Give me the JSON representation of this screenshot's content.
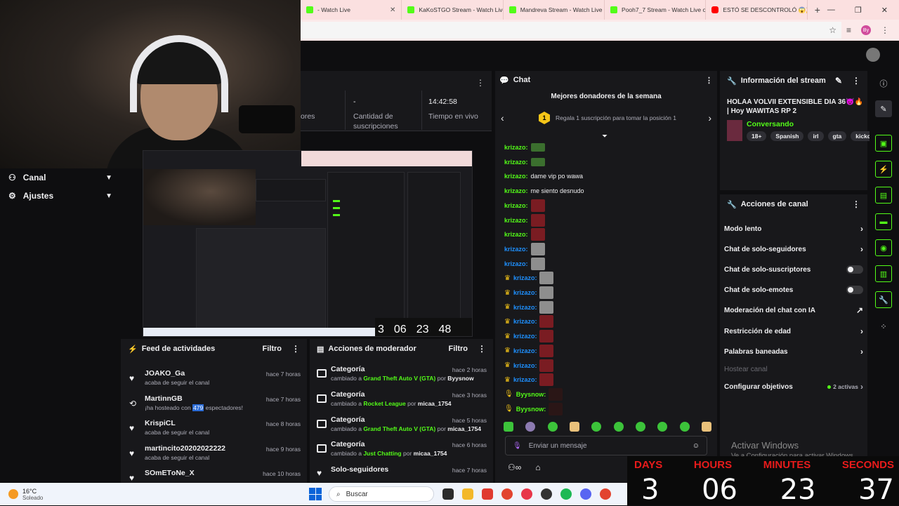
{
  "browser": {
    "tabs": [
      {
        "label": "- Watch Live",
        "icon": "kick-icon"
      },
      {
        "label": "KaKoSTGO Stream - Watch Live",
        "icon": "kick-icon"
      },
      {
        "label": "Mandreva Stream - Watch Live",
        "icon": "kick-icon"
      },
      {
        "label": "Pooh7_7 Stream - Watch Live o",
        "icon": "kick-icon"
      },
      {
        "label": "ESTÓ SE DESCONTROLÓ 😱🎉 ",
        "icon": "youtube-icon"
      }
    ],
    "new_tab": "+",
    "window_controls": [
      "—",
      "❐",
      "✕"
    ],
    "profile_initials": "By"
  },
  "stats": {
    "left_label": "ores",
    "subs_value": "-",
    "subs_label": "Cantidad de suscripciones",
    "uptime_value": "14:42:58",
    "uptime_label": "Tiempo en vivo"
  },
  "sidebar": {
    "items": [
      {
        "label": "Canal",
        "icon": "channel-icon"
      },
      {
        "label": "Ajustes",
        "icon": "settings-icon"
      }
    ]
  },
  "preview_timer": {
    "d": "3",
    "h": "06",
    "m": "23",
    "s": "48"
  },
  "activity_feed": {
    "title": "Feed de actividades",
    "filter": "Filtro",
    "items": [
      {
        "name": "JOAKO_Ga",
        "time": "hace 7 horas",
        "desc": "acaba de seguir el canal",
        "icon": "heart-icon"
      },
      {
        "name": "MartinnGB",
        "time": "hace 7 horas",
        "desc_pre": "¡ha hosteado con ",
        "desc_num": "479",
        "desc_post": " espectadores!",
        "icon": "host-icon"
      },
      {
        "name": "KrispiCL",
        "time": "hace 8 horas",
        "desc": "acaba de seguir el canal",
        "icon": "heart-icon"
      },
      {
        "name": "martincito20202022222",
        "time": "hace 9 horas",
        "desc": "acaba de seguir el canal",
        "icon": "heart-icon"
      },
      {
        "name": "SOmETоNe_X",
        "time": "hace 10 horas",
        "desc": "",
        "icon": "heart-icon"
      }
    ]
  },
  "mod_actions": {
    "title": "Acciones de moderador",
    "filter": "Filtro",
    "items": [
      {
        "title": "Categoría",
        "time": "hace 2 horas",
        "pre": "cambiado a ",
        "value": "Grand Theft Auto V (GTA)",
        "by": " por ",
        "user": "Byysnow"
      },
      {
        "title": "Categoría",
        "time": "hace 3 horas",
        "pre": "cambiado a ",
        "value": "Rocket League",
        "by": " por ",
        "user": "micaa_1754"
      },
      {
        "title": "Categoría",
        "time": "hace 5 horas",
        "pre": "cambiado a ",
        "value": "Grand Theft Auto V (GTA)",
        "by": " por ",
        "user": "micaa_1754"
      },
      {
        "title": "Categoría",
        "time": "hace 6 horas",
        "pre": "cambiado a ",
        "value": "Just Chatting",
        "by": " por ",
        "user": "micaa_1754"
      },
      {
        "title": "Solo-seguidores",
        "time": "hace 7 horas",
        "pre": "",
        "value": "",
        "by": "",
        "user": ""
      }
    ]
  },
  "chat": {
    "title": "Chat",
    "donors_title": "Mejores donadores de la semana",
    "donor_rank": "1",
    "donor_text": "Regala 1 suscripción para tomar la posición 1",
    "messages": [
      {
        "user": "krizazo:",
        "text": "",
        "emote": "grn",
        "color": "#53fc18",
        "crown": false
      },
      {
        "user": "krizazo:",
        "text": "",
        "emote": "grn",
        "color": "#53fc18",
        "crown": false
      },
      {
        "user": "krizazo:",
        "text": "dame vip po wawa",
        "emote": "",
        "color": "#53fc18",
        "crown": false
      },
      {
        "user": "krizazo:",
        "text": "me siento desnudo",
        "emote": "",
        "color": "#53fc18",
        "crown": false
      },
      {
        "user": "krizazo:",
        "text": "",
        "emote": "red",
        "color": "#53fc18",
        "crown": false
      },
      {
        "user": "krizazo:",
        "text": "",
        "emote": "red",
        "color": "#53fc18",
        "crown": false
      },
      {
        "user": "krizazo:",
        "text": "",
        "emote": "red",
        "color": "#53fc18",
        "crown": false
      },
      {
        "user": "krizazo:",
        "text": "",
        "emote": "gry",
        "color": "#1e90ff",
        "crown": false
      },
      {
        "user": "krizazo:",
        "text": "",
        "emote": "gry",
        "color": "#1e90ff",
        "crown": false
      },
      {
        "user": "krizazo:",
        "text": "",
        "emote": "gry",
        "color": "#1e90ff",
        "crown": true
      },
      {
        "user": "krizazo:",
        "text": "",
        "emote": "gry",
        "color": "#1e90ff",
        "crown": true
      },
      {
        "user": "krizazo:",
        "text": "",
        "emote": "gry",
        "color": "#1e90ff",
        "crown": true
      },
      {
        "user": "krizazo:",
        "text": "",
        "emote": "red",
        "color": "#1e90ff",
        "crown": true
      },
      {
        "user": "krizazo:",
        "text": "",
        "emote": "red",
        "color": "#1e90ff",
        "crown": true
      },
      {
        "user": "krizazo:",
        "text": "",
        "emote": "red",
        "color": "#1e90ff",
        "crown": true
      },
      {
        "user": "krizazo:",
        "text": "",
        "emote": "red",
        "color": "#1e90ff",
        "crown": true
      },
      {
        "user": "krizazo:",
        "text": "",
        "emote": "red",
        "color": "#1e90ff",
        "crown": true
      },
      {
        "user": "Byysnow:",
        "text": "",
        "emote": "dk",
        "color": "#53fc18",
        "crown": false
      },
      {
        "user": "Byysnow:",
        "text": "",
        "emote": "dk",
        "color": "#53fc18",
        "crown": false
      }
    ],
    "input_placeholder": "Enviar un mensaje"
  },
  "stream_info": {
    "title": "Información del stream",
    "stream_title": "HOLAA VOLVII EXTENSIBLE DIA 36😈🔥 | Hoy WAWITAS RP 2",
    "category": "Conversando",
    "tags": [
      "18+",
      "Spanish",
      "irl",
      "gta",
      "kickchi"
    ]
  },
  "channel_actions": {
    "title": "Acciones de canal",
    "rows": [
      {
        "label": "Modo lento",
        "type": "arrow"
      },
      {
        "label": "Chat de solo-seguidores",
        "type": "arrow"
      },
      {
        "label": "Chat de solo-suscriptores",
        "type": "toggle"
      },
      {
        "label": "Chat de solo-emotes",
        "type": "toggle"
      },
      {
        "label": "Moderación del chat con IA",
        "type": "external"
      },
      {
        "label": "Restricción de edad",
        "type": "arrow"
      },
      {
        "label": "Palabras baneadas",
        "type": "arrow"
      },
      {
        "label": "Hostear canal",
        "type": "disabled"
      },
      {
        "label": "Configurar objetivos",
        "type": "count",
        "count": "2 activas"
      }
    ],
    "activate_line1": "Activar Windows",
    "activate_line2": "Ve a Configuración para activar Windows."
  },
  "timer": {
    "labels": [
      "DAYS",
      "HOURS",
      "MINUTES",
      "SECONDS"
    ],
    "values": [
      "3",
      "06",
      "23",
      "37"
    ]
  },
  "taskbar": {
    "temp": "16°C",
    "weather": "Soleado",
    "search_placeholder": "Buscar"
  },
  "colors": {
    "accent": "#53fc18",
    "bg": "#0e0e10",
    "panel": "#18181b",
    "timer_label": "#e81b1b"
  }
}
